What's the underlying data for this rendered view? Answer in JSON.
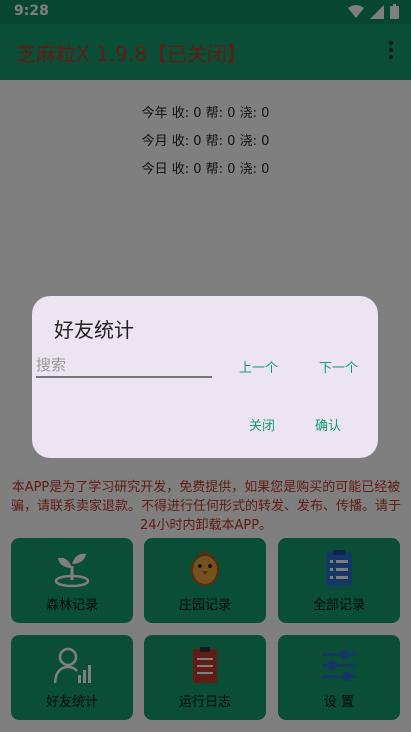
{
  "status": {
    "time": "9:28"
  },
  "app": {
    "title": "芝麻粒X 1.9.8【已关闭】"
  },
  "stats": {
    "year": "今年 收: 0 帮: 0 浇: 0",
    "month": "今月 收: 0 帮: 0 浇: 0",
    "day": "今日 收: 0 帮: 0 浇: 0"
  },
  "notice": "本APP是为了学习研究开发，免费提供，如果您是购买的可能已经被骗，请联系卖家退款。不得进行任何形式的转发、发布、传播。请于24小时内卸载本APP。",
  "tiles": [
    {
      "label": "森林记录",
      "icon": "seedling-icon"
    },
    {
      "label": "庄园记录",
      "icon": "chick-icon"
    },
    {
      "label": "全部记录",
      "icon": "clipboard-list-icon"
    },
    {
      "label": "好友统计",
      "icon": "user-chart-icon"
    },
    {
      "label": "运行日志",
      "icon": "log-icon"
    },
    {
      "label": "设 置",
      "icon": "sliders-icon"
    }
  ],
  "dialog": {
    "title": "好友统计",
    "search_placeholder": "搜索",
    "search_value": "",
    "prev": "上一个",
    "next": "下一个",
    "close": "关闭",
    "confirm": "确认"
  },
  "colors": {
    "accent": "#149d70",
    "title_red": "#c0392b",
    "dialog_bg": "#ece4f0"
  }
}
